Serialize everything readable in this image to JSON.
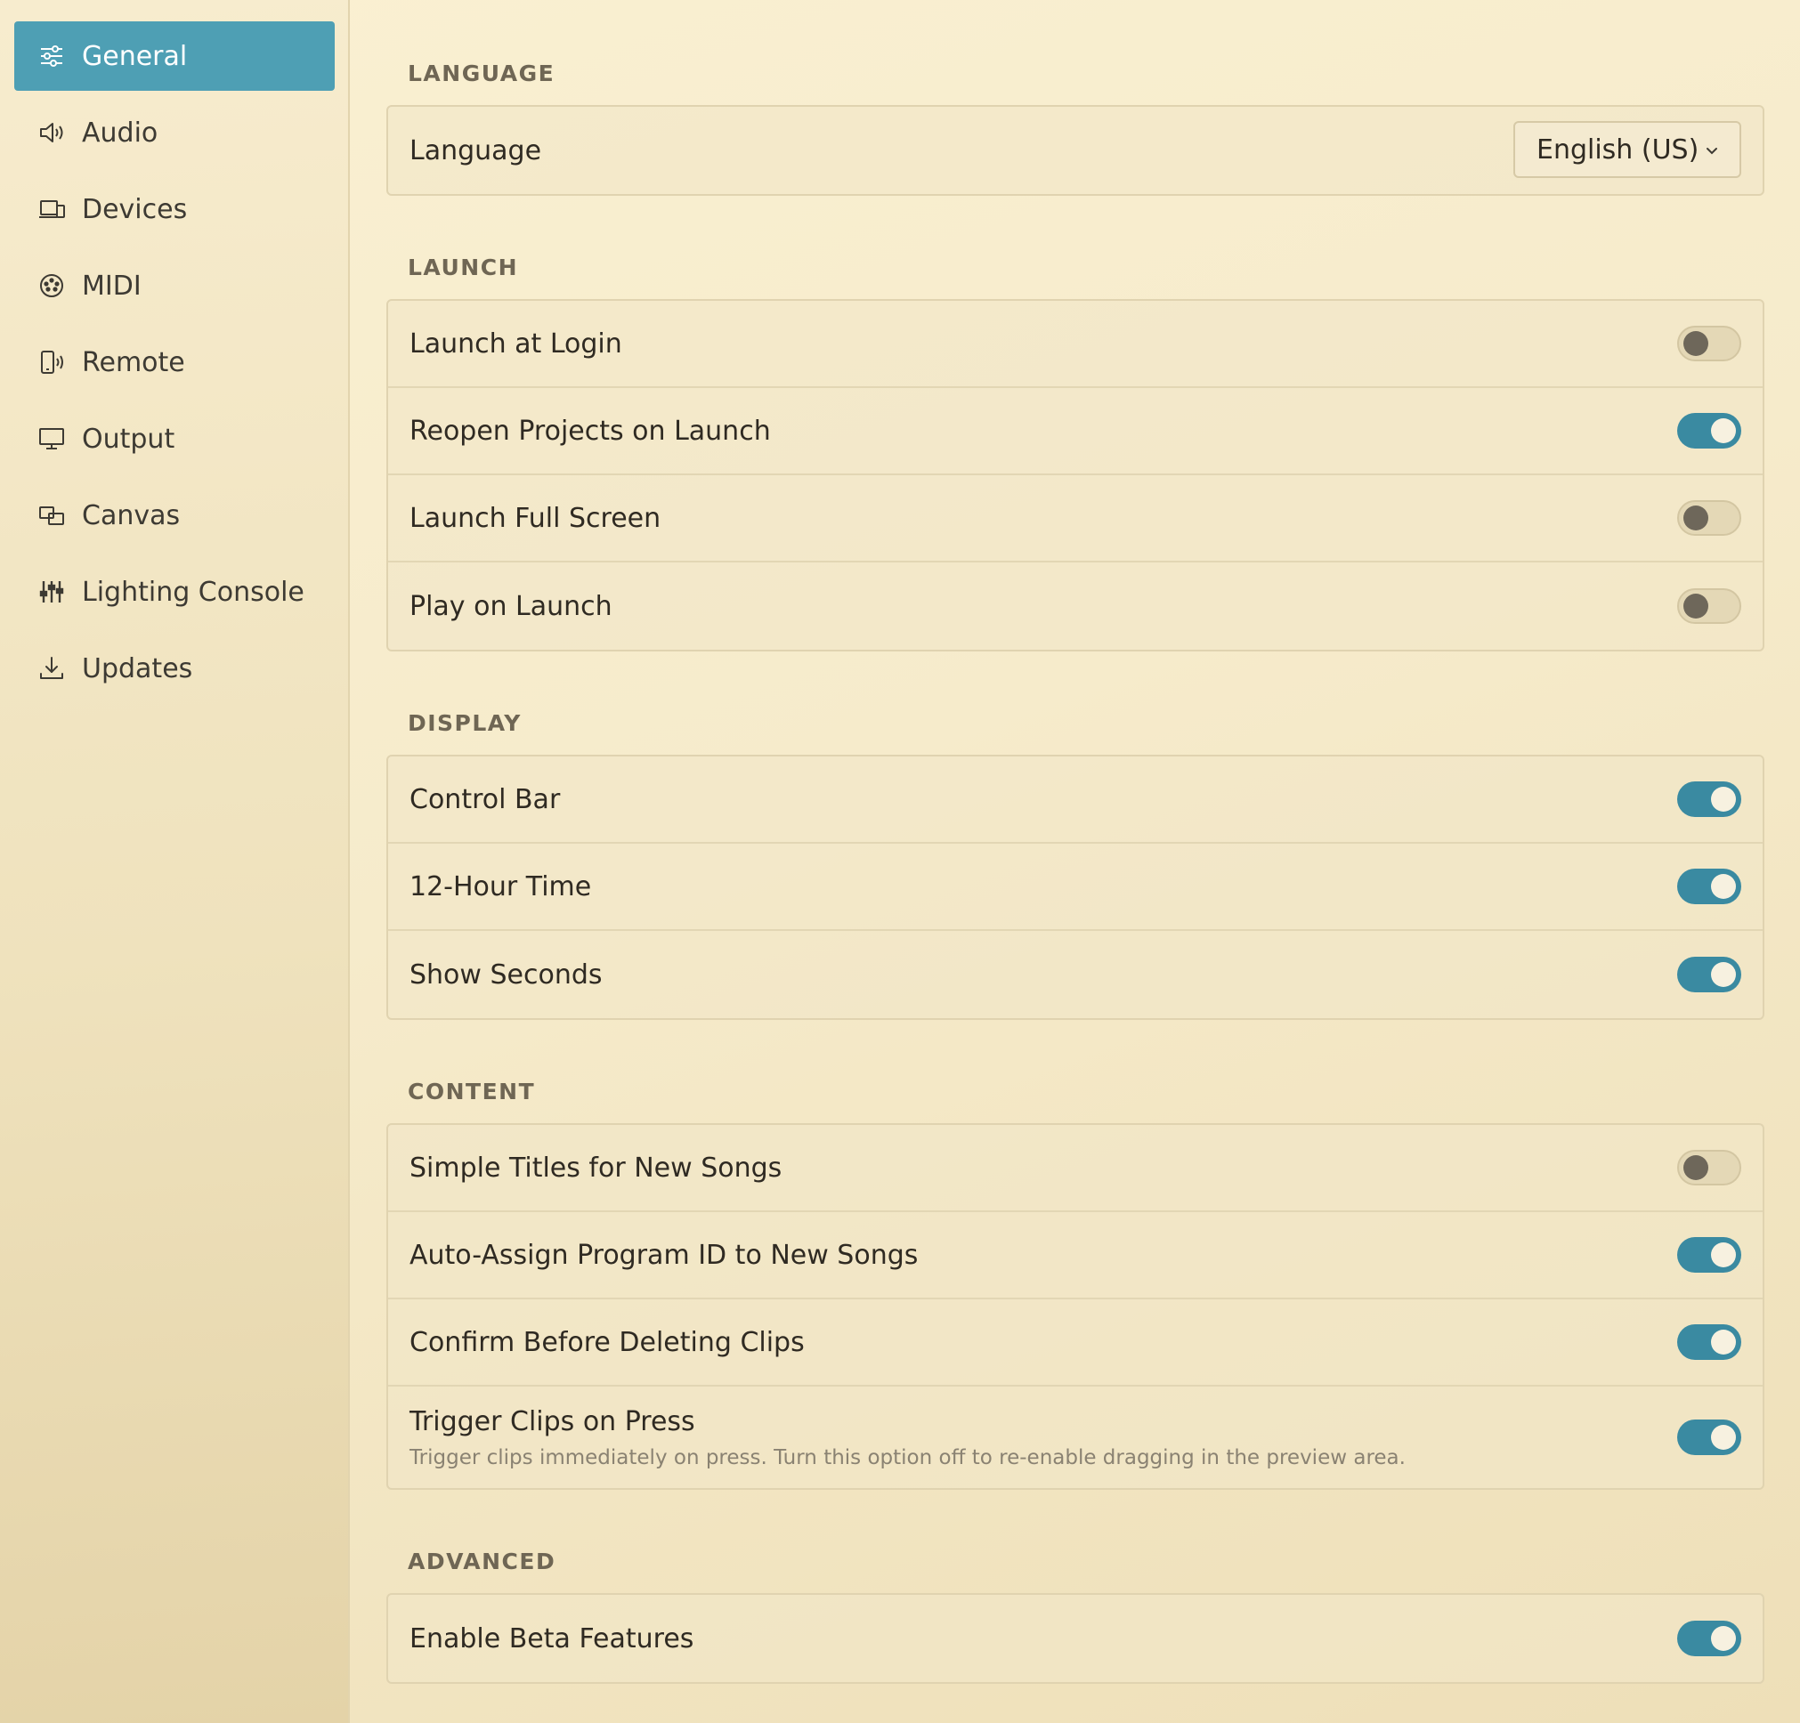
{
  "sidebar": {
    "items": [
      {
        "label": "General",
        "icon": "sliders-icon",
        "active": true
      },
      {
        "label": "Audio",
        "icon": "speaker-icon"
      },
      {
        "label": "Devices",
        "icon": "devices-icon"
      },
      {
        "label": "MIDI",
        "icon": "midi-icon"
      },
      {
        "label": "Remote",
        "icon": "remote-icon"
      },
      {
        "label": "Output",
        "icon": "monitor-icon"
      },
      {
        "label": "Canvas",
        "icon": "canvas-icon"
      },
      {
        "label": "Lighting Console",
        "icon": "faders-icon"
      },
      {
        "label": "Updates",
        "icon": "download-icon"
      }
    ]
  },
  "sections": {
    "language": {
      "title": "LANGUAGE",
      "row_label": "Language",
      "selected": "English (US)"
    },
    "launch": {
      "title": "LAUNCH",
      "rows": [
        {
          "label": "Launch at Login",
          "on": false
        },
        {
          "label": "Reopen Projects on Launch",
          "on": true
        },
        {
          "label": "Launch Full Screen",
          "on": false
        },
        {
          "label": "Play on Launch",
          "on": false
        }
      ]
    },
    "display": {
      "title": "DISPLAY",
      "rows": [
        {
          "label": "Control Bar",
          "on": true
        },
        {
          "label": "12-Hour Time",
          "on": true
        },
        {
          "label": "Show Seconds",
          "on": true
        }
      ]
    },
    "content": {
      "title": "CONTENT",
      "rows": [
        {
          "label": "Simple Titles for New Songs",
          "on": false
        },
        {
          "label": "Auto-Assign Program ID to New Songs",
          "on": true
        },
        {
          "label": "Confirm Before Deleting Clips",
          "on": true
        },
        {
          "label": "Trigger Clips on Press",
          "description": "Trigger clips immediately on press. Turn this option off to re-enable dragging in the preview area.",
          "on": true
        }
      ]
    },
    "advanced": {
      "title": "ADVANCED",
      "rows": [
        {
          "label": "Enable Beta Features",
          "on": true
        }
      ]
    }
  },
  "colors": {
    "accent": "#4e9fb4",
    "toggle_on": "#3a8aa1",
    "background": "#f6ebcb"
  }
}
